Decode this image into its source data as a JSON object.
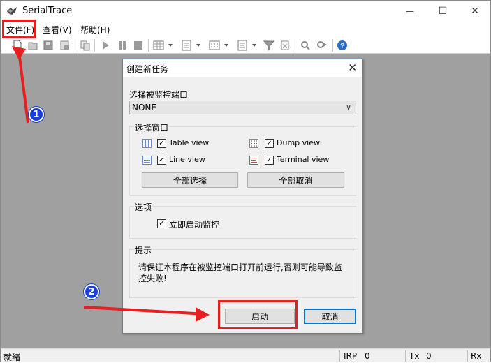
{
  "window": {
    "title": "SerialTrace",
    "controls": {
      "minimize": "—",
      "maximize": "☐",
      "close": "✕"
    }
  },
  "menu": [
    {
      "label": "文件(F)"
    },
    {
      "label": "查看(V)"
    },
    {
      "label": "帮助(H)"
    }
  ],
  "toolbar": {
    "icons": [
      "new-task-icon",
      "open-icon",
      "save-icon",
      "save-as-icon",
      "copy-icon",
      "start-icon",
      "pause-icon",
      "stop-icon",
      "table-view-icon",
      "line-view-icon",
      "dump-view-icon",
      "terminal-view-icon",
      "filter-icon",
      "clear-icon",
      "find-icon",
      "find-next-icon",
      "help-icon"
    ]
  },
  "dialog": {
    "title": "创建新任务",
    "port_label": "选择被监控端口",
    "port_value": "NONE",
    "window_group_title": "选择窗口",
    "views": [
      {
        "label": "Table view",
        "checked": true,
        "icon": "table-view-icon"
      },
      {
        "label": "Dump view",
        "checked": true,
        "icon": "dump-view-icon"
      },
      {
        "label": "Line view",
        "checked": true,
        "icon": "line-view-icon"
      },
      {
        "label": "Terminal view",
        "checked": true,
        "icon": "terminal-view-icon"
      }
    ],
    "select_all": "全部选择",
    "deselect_all": "全部取消",
    "options_group_title": "选项",
    "start_immediately": "立即启动监控",
    "hint_group_title": "提示",
    "hint_text": "请保证本程序在被监控端口打开前运行,否则可能导致监控失败!",
    "start_button": "启动",
    "cancel_button": "取消"
  },
  "statusbar": {
    "status": "就绪",
    "irp_label": "IRP",
    "irp_value": "0",
    "tx_label": "Tx",
    "tx_value": "0",
    "rx_label": "Rx"
  },
  "annotations": {
    "badge1": "1",
    "badge2": "2",
    "color": "#e62020"
  },
  "colors": {
    "workspace": "#a0a0a0",
    "dialog": "#f0f0f0",
    "annotation_red": "#e62020",
    "badge_blue": "#1a3fd6"
  }
}
